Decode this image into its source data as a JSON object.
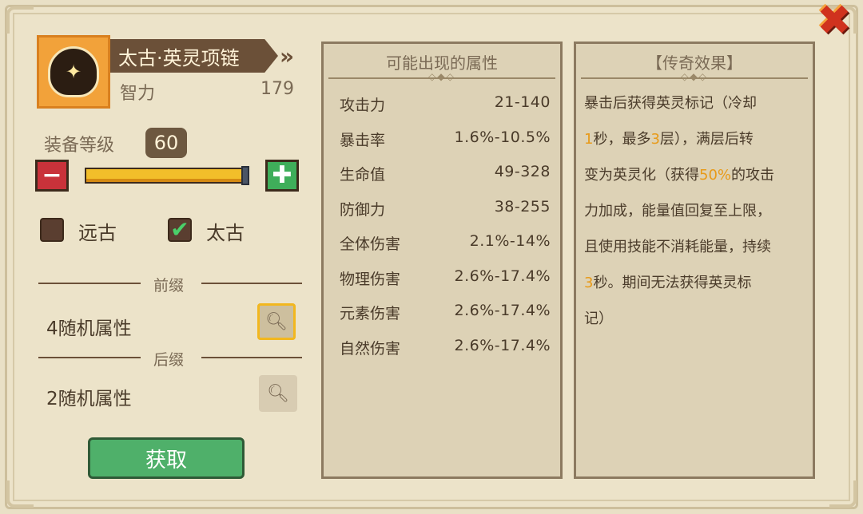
{
  "item": {
    "name": "太古·英灵项链",
    "stat_name": "智力",
    "stat_value": "179"
  },
  "level": {
    "label": "装备等级",
    "value": "60",
    "slider_fraction": 1.0
  },
  "rarity": {
    "option1": {
      "label": "远古",
      "checked": false
    },
    "option2": {
      "label": "太古",
      "checked": true
    }
  },
  "prefix": {
    "label": "前缀",
    "text": "4随机属性"
  },
  "suffix": {
    "label": "后缀",
    "text": "2随机属性"
  },
  "get_button": "获取",
  "attributes_panel": {
    "title": "可能出现的属性",
    "rows": [
      {
        "name": "攻击力",
        "range": "21-140"
      },
      {
        "name": "暴击率",
        "range": "1.6%-10.5%"
      },
      {
        "name": "生命值",
        "range": "49-328"
      },
      {
        "name": "防御力",
        "range": "38-255"
      },
      {
        "name": "全体伤害",
        "range": "2.1%-14%"
      },
      {
        "name": "物理伤害",
        "range": "2.6%-17.4%"
      },
      {
        "name": "元素伤害",
        "range": "2.6%-17.4%"
      },
      {
        "name": "自然伤害",
        "range": "2.6%-17.4%"
      }
    ]
  },
  "legend_panel": {
    "title": "【传奇效果】",
    "lines": [
      [
        {
          "t": "暴击后获得英灵标记（冷却",
          "hl": false
        }
      ],
      [
        {
          "t": "1",
          "hl": true
        },
        {
          "t": "秒，最多",
          "hl": false
        },
        {
          "t": "3",
          "hl": true
        },
        {
          "t": "层），满层后转",
          "hl": false
        }
      ],
      [
        {
          "t": "变为英灵化（获得",
          "hl": false
        },
        {
          "t": "50%",
          "hl": true
        },
        {
          "t": "的攻击",
          "hl": false
        }
      ],
      [
        {
          "t": "力加成，能量值回复至上限，",
          "hl": false
        }
      ],
      [
        {
          "t": "且使用技能不消耗能量，持续",
          "hl": false
        }
      ],
      [
        {
          "t": "3",
          "hl": true
        },
        {
          "t": "秒。期间无法获得英灵标",
          "hl": false
        }
      ],
      [
        {
          "t": "记）",
          "hl": false
        }
      ]
    ]
  },
  "icons": {
    "close": "close-icon",
    "item": "necklace-icon",
    "minus": "minus-icon",
    "plus": "plus-icon",
    "search": "magnifier-icon",
    "check": "checkmark-icon"
  },
  "colors": {
    "highlight": "#e89a18",
    "get_button": "#4fb06a",
    "plus_button": "#3fae5a",
    "minus_button": "#c9323a",
    "slider_fill": "#f2be2a"
  }
}
